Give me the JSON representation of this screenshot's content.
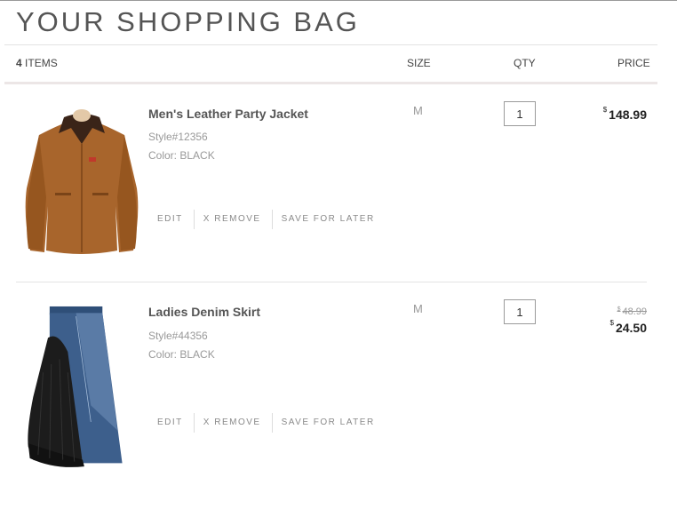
{
  "page": {
    "title": "YOUR SHOPPING BAG"
  },
  "header": {
    "items_count": "4",
    "items_label": "ITEMS",
    "size_label": "SIZE",
    "qty_label": "QTY",
    "price_label": "PRICE"
  },
  "items": [
    {
      "name": "Men's Leather Party Jacket",
      "style": "Style#12356",
      "color": "Color: BLACK",
      "size": "M",
      "qty": "1",
      "currency": "$",
      "price": "148.99",
      "actions": {
        "edit": "EDIT",
        "remove": "X REMOVE",
        "save": "SAVE FOR LATER"
      }
    },
    {
      "name": "Ladies Denim Skirt",
      "style": "Style#44356",
      "color": "Color: BLACK",
      "size": "M",
      "qty": "1",
      "currency": "$",
      "old_price": "48.99",
      "price": "24.50",
      "actions": {
        "edit": "EDIT",
        "remove": "X REMOVE",
        "save": "SAVE FOR LATER"
      }
    }
  ]
}
